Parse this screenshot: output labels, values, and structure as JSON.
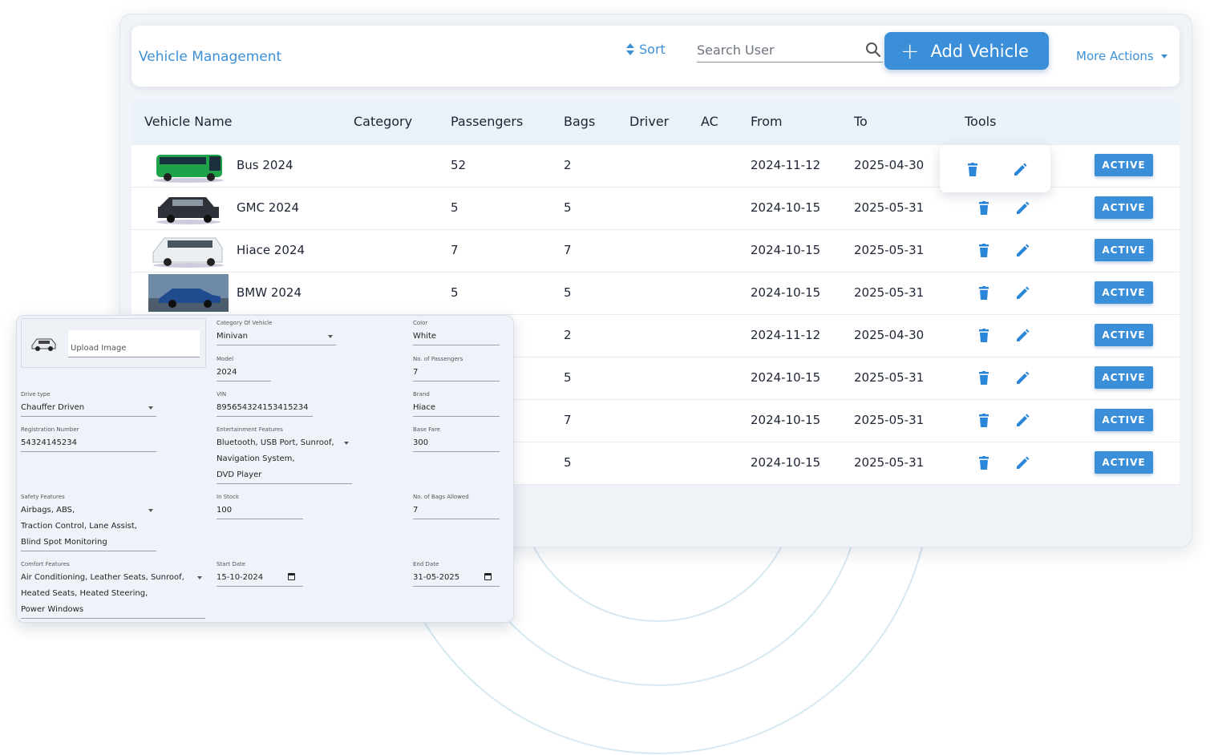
{
  "header": {
    "title": "Vehicle Management",
    "sort_label": "Sort",
    "search_placeholder": "Search User",
    "add_button_label": "Add Vehicle",
    "more_actions_label": "More Actions"
  },
  "table": {
    "columns": [
      "Vehicle Name",
      "Category",
      "Passengers",
      "Bags",
      "Driver",
      "AC",
      "From",
      "To",
      "Tools"
    ],
    "rows": [
      {
        "name": "Bus 2024",
        "category": "",
        "passengers": "52",
        "bags": "2",
        "from": "2024-11-12",
        "to": "2025-04-30",
        "status": "ACTIVE",
        "image": "bus"
      },
      {
        "name": "GMC 2024",
        "category": "",
        "passengers": "5",
        "bags": "5",
        "from": "2024-10-15",
        "to": "2025-05-31",
        "status": "ACTIVE",
        "image": "suv"
      },
      {
        "name": "Hiace 2024",
        "category": "",
        "passengers": "7",
        "bags": "7",
        "from": "2024-10-15",
        "to": "2025-05-31",
        "status": "ACTIVE",
        "image": "van"
      },
      {
        "name": "BMW 2024",
        "category": "",
        "passengers": "5",
        "bags": "5",
        "from": "2024-10-15",
        "to": "2025-05-31",
        "status": "ACTIVE",
        "image": "sedan"
      },
      {
        "name": "",
        "category": "",
        "passengers": "",
        "bags": "2",
        "from": "2024-11-12",
        "to": "2025-04-30",
        "status": "ACTIVE",
        "image": ""
      },
      {
        "name": "",
        "category": "",
        "passengers": "",
        "bags": "5",
        "from": "2024-10-15",
        "to": "2025-05-31",
        "status": "ACTIVE",
        "image": ""
      },
      {
        "name": "",
        "category": "",
        "passengers": "",
        "bags": "7",
        "from": "2024-10-15",
        "to": "2025-05-31",
        "status": "ACTIVE",
        "image": ""
      },
      {
        "name": "",
        "category": "",
        "passengers": "",
        "bags": "5",
        "from": "2024-10-15",
        "to": "2025-05-31",
        "status": "ACTIVE",
        "image": ""
      }
    ]
  },
  "form": {
    "upload_label": "Upload Image",
    "fields": {
      "category": {
        "label": "Category Of Vehicle",
        "value": "Minivan"
      },
      "color": {
        "label": "Color",
        "value": "White"
      },
      "model": {
        "label": "Model",
        "value": "2024"
      },
      "passengers": {
        "label": "No. of Passengers",
        "value": "7"
      },
      "drive_type": {
        "label": "Drive type",
        "value": "Chauffer Driven"
      },
      "vin": {
        "label": "VIN",
        "value": "895654324153415234"
      },
      "brand": {
        "label": "Brand",
        "value": "Hiace"
      },
      "registration": {
        "label": "Registration Number",
        "value": "54324145234"
      },
      "entertainment": {
        "label": "Entertainment Features",
        "line1": "Bluetooth, USB Port, Sunroof,",
        "line2": "Navigation System,",
        "line3": "DVD Player"
      },
      "base_fare": {
        "label": "Base Fare",
        "value": "300"
      },
      "safety": {
        "label": "Safety Features",
        "line1": "Airbags, ABS,",
        "line2": "Traction Control, Lane Assist,",
        "line3": "Blind Spot Monitoring"
      },
      "in_stock": {
        "label": "In Stock",
        "value": "100"
      },
      "bags": {
        "label": "No. of Bags Allowed",
        "value": "7"
      },
      "comfort": {
        "label": "Comfort Features",
        "line1": "Air Conditioning, Leather Seats, Sunroof,",
        "line2": "Heated Seats, Heated Steering,",
        "line3": "Power Windows"
      },
      "start_date": {
        "label": "Start Date",
        "value": "15-10-2024"
      },
      "end_date": {
        "label": "End Date",
        "value": "31-05-2025"
      }
    }
  },
  "colors": {
    "accent": "#3b8ed8",
    "header_bg": "#eaf1f9",
    "panel_bg": "#f0f3f8"
  },
  "icons": [
    "sort-icon",
    "search-icon",
    "plus-icon",
    "caret-down-icon",
    "trash-icon",
    "pencil-icon",
    "calendar-icon",
    "car-icon"
  ]
}
